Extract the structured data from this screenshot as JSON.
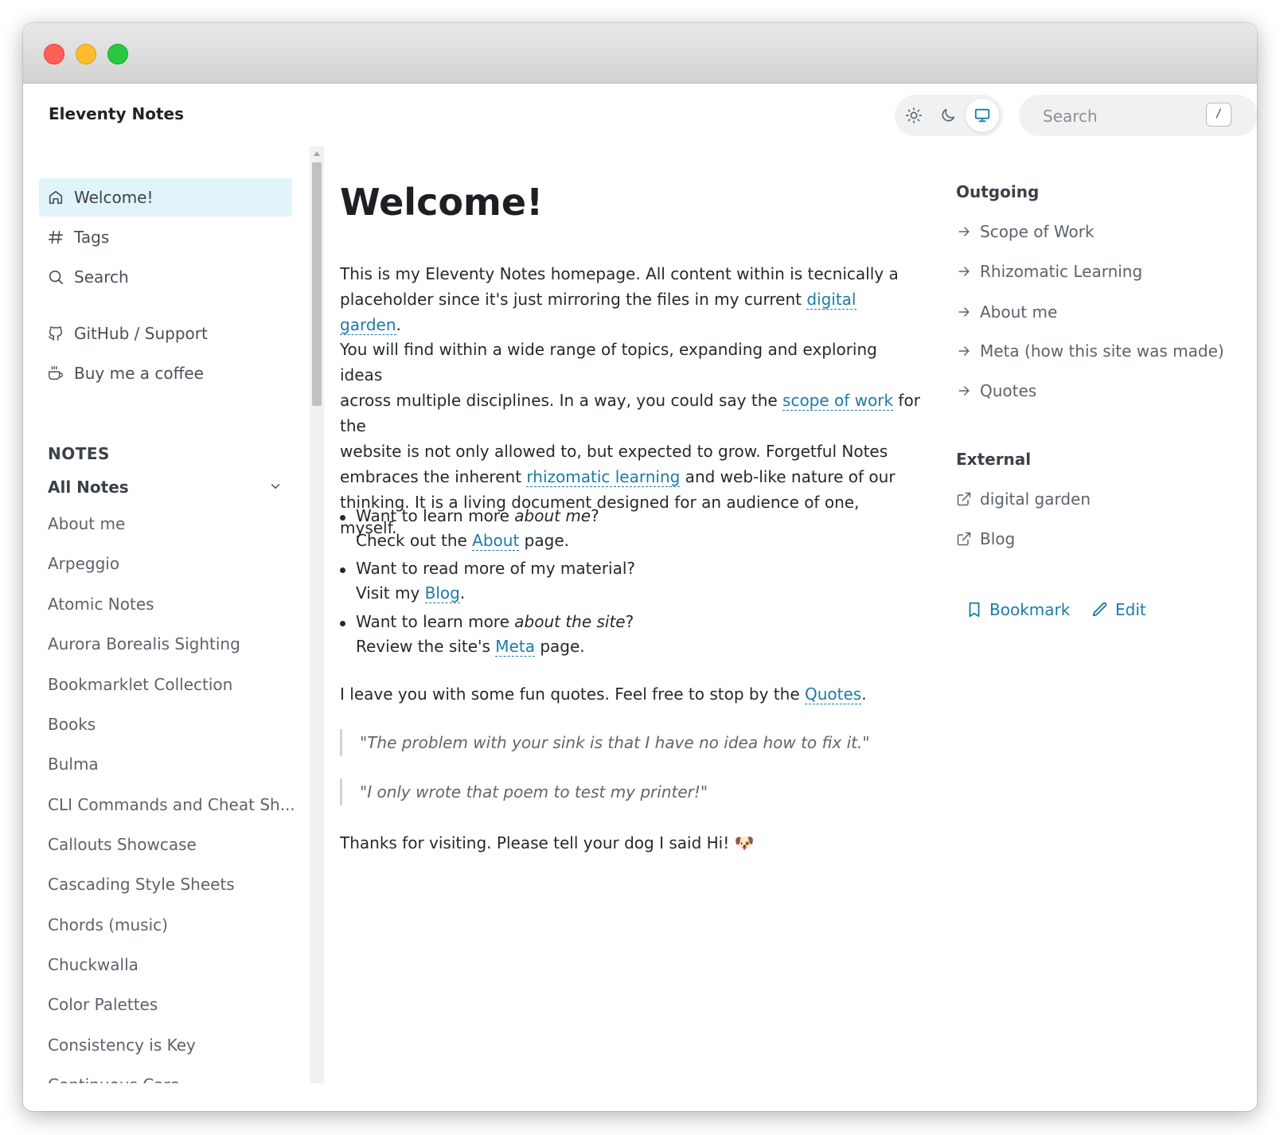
{
  "header": {
    "app_title": "Eleventy Notes",
    "theme_buttons": [
      {
        "name": "light",
        "icon": "sun-icon"
      },
      {
        "name": "dark",
        "icon": "moon-icon"
      },
      {
        "name": "system",
        "icon": "monitor-icon",
        "active": true
      }
    ],
    "search": {
      "placeholder": "Search",
      "shortcut": "/"
    }
  },
  "sidebar": {
    "nav": [
      {
        "label": "Welcome!",
        "icon": "home-icon",
        "active": true
      },
      {
        "label": "Tags",
        "icon": "hash-icon"
      },
      {
        "label": "Search",
        "icon": "search-icon"
      },
      {
        "label": "GitHub / Support",
        "icon": "github-icon"
      },
      {
        "label": "Buy me a coffee",
        "icon": "coffee-icon"
      }
    ],
    "section_label": "NOTES",
    "group_label": "All Notes",
    "notes": [
      "About me",
      "Arpeggio",
      "Atomic Notes",
      "Aurora Borealis Sighting",
      "Bookmarklet Collection",
      "Books",
      "Bulma",
      "CLI Commands and Cheat Sh...",
      "Callouts Showcase",
      "Cascading Style Sheets",
      "Chords (music)",
      "Chuckwalla",
      "Color Palettes",
      "Consistency is Key",
      "Continuous Care"
    ]
  },
  "content": {
    "title": "Welcome!",
    "p1_a": "This is my Eleventy Notes homepage. All content within is tecnically a",
    "p1_b": "placeholder since it's just mirroring the files in my current ",
    "p1_link": "digital garden",
    "p1_end": ".",
    "p2_l1": "You will find within a wide range of topics, expanding and exploring ideas",
    "p2_l2a": "across multiple disciplines. In a way, you could say the ",
    "p2_l2link": "scope of work",
    "p2_l2b": " for the",
    "p2_l3": "website is not only allowed to, but expected to grow. Forgetful Notes",
    "p2_l4a": "embraces the inherent ",
    "p2_l4link": "rhizomatic learning",
    "p2_l4b": " and web-like nature of our",
    "p2_l5": "thinking. It is a living document designed for an audience of one, myself.",
    "b1_a": "Want to learn more ",
    "b1_em": "about me",
    "b1_b": "?",
    "b1_c": "Check out the ",
    "b1_link": "About",
    "b1_d": " page.",
    "b2_a": "Want to read more of my material?",
    "b2_b": "Visit my ",
    "b2_link": "Blog",
    "b2_c": ".",
    "b3_a": "Want to learn more ",
    "b3_em": "about the site",
    "b3_b": "?",
    "b3_c": "Review the site's ",
    "b3_link": "Meta",
    "b3_d": " page.",
    "p3_a": "I leave you with some fun quotes. Feel free to stop by the ",
    "p3_link": "Quotes",
    "p3_b": ".",
    "quote1": "\"The problem with your sink is that I have no idea how to fix it.\"",
    "quote2": "\"I only wrote that poem to test my printer!\"",
    "p4": "Thanks for visiting. Please tell your dog I said Hi! 🐶"
  },
  "aside": {
    "outgoing_title": "Outgoing",
    "outgoing": [
      "Scope of Work",
      "Rhizomatic Learning",
      "About me",
      "Meta (how this site was made)",
      "Quotes"
    ],
    "external_title": "External",
    "external": [
      "digital garden",
      "Blog"
    ],
    "bookmark_label": "Bookmark",
    "edit_label": "Edit"
  },
  "colors": {
    "accent": "#1c7ba6",
    "active_bg": "#e1f4fa"
  }
}
